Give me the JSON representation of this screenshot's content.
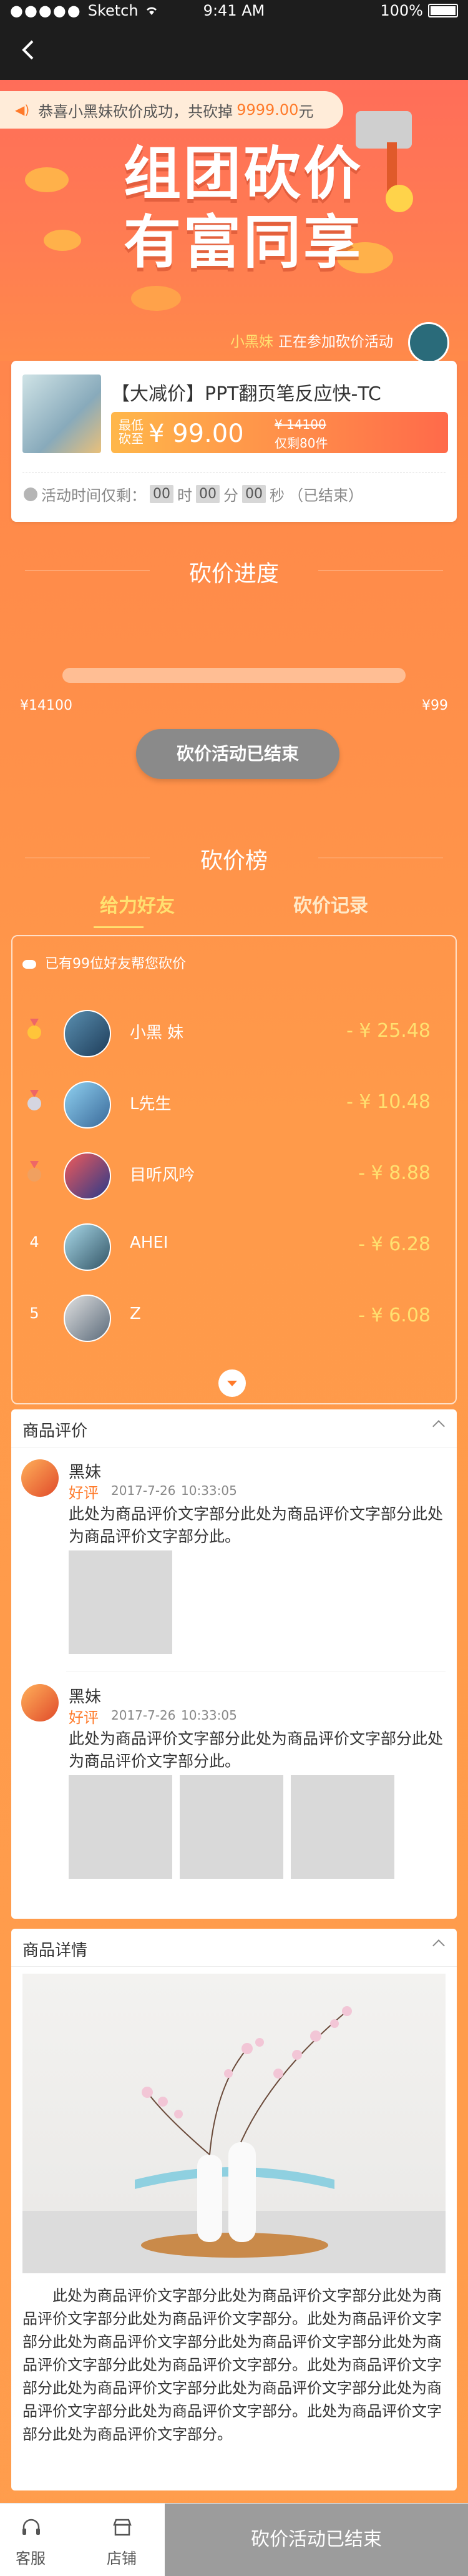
{
  "statusbar": {
    "carrier": "Sketch",
    "time": "9:41 AM",
    "battery": "100%"
  },
  "notice": {
    "text": "恭喜小黑妹砍价成功，共砍掉",
    "amount": "9999.00",
    "unit": "元"
  },
  "hero": {
    "title_line1": "组团砍价",
    "title_line2": "有富同享",
    "joiner_name": "小黑妹",
    "joiner_text": "正在参加砍价活动"
  },
  "product": {
    "name": "【大减价】PPT翻页笔反应快-TC",
    "price_label": "最低砍至",
    "price": "¥ 99.00",
    "old_price": "¥ 14100",
    "remaining": "仅剩80件",
    "time_label": "活动时间仅剩：",
    "time_units": [
      "00",
      "时",
      "00",
      "分",
      "00",
      "秒"
    ],
    "time_status": "（已结束）"
  },
  "progress": {
    "title": "砍价进度",
    "start": "¥14100",
    "end": "¥99",
    "percent": 0,
    "button": "砍价活动已结束"
  },
  "ranking": {
    "title": "砍价榜",
    "tab_friends": "给力好友",
    "tab_records": "砍价记录",
    "header": "已有99位好友帮您砍价",
    "rows": [
      {
        "rank": "1",
        "name": "小黑 妹",
        "amount": "- ¥ 25.48",
        "medal": "gold-medal-icon"
      },
      {
        "rank": "2",
        "name": "L先生",
        "amount": "- ¥ 10.48",
        "medal": "silver-medal-icon"
      },
      {
        "rank": "3",
        "name": "目听风吟",
        "amount": "- ¥ 8.88",
        "medal": "bronze-medal-icon"
      },
      {
        "rank": "4",
        "name": "AHEI",
        "amount": "- ¥ 6.28"
      },
      {
        "rank": "5",
        "name": "Z",
        "amount": "- ¥ 6.08"
      }
    ]
  },
  "reviews": {
    "title": "商品评价",
    "items": [
      {
        "name": "黑妹",
        "rating": "好评",
        "date": "2017-7-26",
        "time": "10:33:05",
        "text": "此处为商品评价文字部分此处为商品评价文字部分此处为商品评价文字部分此。",
        "images": 1
      },
      {
        "name": "黑妹",
        "rating": "好评",
        "date": "2017-7-26",
        "time": "10:33:05",
        "text": "此处为商品评价文字部分此处为商品评价文字部分此处为商品评价文字部分此。",
        "images": 3
      }
    ]
  },
  "details": {
    "title": "商品详情",
    "text": "此处为商品评价文字部分此处为商品评价文字部分此处为商品评价文字部分此处为商品评价文字部分。此处为商品评价文字部分此处为商品评价文字部分此处为商品评价文字部分此处为商品评价文字部分此处为商品评价文字部分。此处为商品评价文字部分此处为商品评价文字部分此处为商品评价文字部分此处为商品评价文字部分此处为商品评价文字部分。此处为商品评价文字部分此处为商品评价文字部分。"
  },
  "bottombar": {
    "service": "客服",
    "store": "店铺",
    "ended": "砍价活动已结束"
  },
  "colors": {
    "accent": "#ff7a2a",
    "yellow": "#ffe070",
    "bg": "#ff9a4a",
    "disabled": "#9c9c9c"
  }
}
